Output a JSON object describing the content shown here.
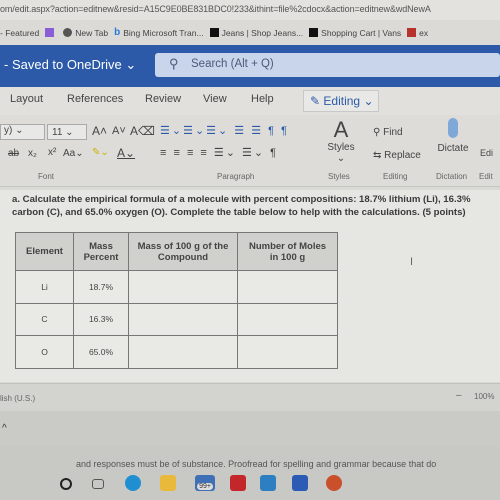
{
  "browser": {
    "url": "om/edit.aspx?action=editnew&resid=A15C9E0BE831BDC0!233&ithint=file%2cdocx&action=editnew&wdNewA",
    "bookmarks": [
      {
        "label": "- Featured",
        "icon": "none"
      },
      {
        "label": "",
        "icon": "twitch-icon"
      },
      {
        "label": "New Tab",
        "icon": "globe-icon"
      },
      {
        "label": "Bing Microsoft Tran...",
        "icon": "bing-icon"
      },
      {
        "label": "Jeans | Shop Jeans...",
        "icon": "vans-icon"
      },
      {
        "label": "Shopping Cart | Vans",
        "icon": "vans-icon"
      },
      {
        "label": "ex",
        "icon": "sy-icon"
      }
    ]
  },
  "header": {
    "saved": "- Saved to OneDrive",
    "search_placeholder": "Search (Alt + Q)",
    "brand_color": "#2c5aa8"
  },
  "tabs": [
    "Layout",
    "References",
    "Review",
    "View",
    "Help"
  ],
  "editing_mode": "Editing",
  "ribbon": {
    "font_size": "11",
    "groups": [
      "Font",
      "Paragraph",
      "Styles",
      "Editing",
      "Dictation",
      "Edit"
    ],
    "styles": "Styles",
    "find": "Find",
    "replace": "Replace",
    "dictate": "Dictate",
    "editor": "Edi"
  },
  "document": {
    "question": "a. Calculate the empirical formula of a molecule with percent compositions: 18.7% lithium (Li), 16.3% carbon (C), and 65.0% oxygen (O). Complete the table below to help with the calculations. (5 points)",
    "table": {
      "headers": [
        "Element",
        "Mass Percent",
        "Mass of 100 g of the Compound",
        "Number of Moles in 100 g"
      ],
      "rows": [
        [
          "Li",
          "18.7%",
          "",
          ""
        ],
        [
          "C",
          "16.3%",
          "",
          ""
        ],
        [
          "O",
          "65.0%",
          "",
          ""
        ]
      ]
    }
  },
  "status": {
    "language": "lish (U.S.)",
    "zoom": "100%"
  },
  "background_text": "and responses must be of substance. Proofread for spelling and grammar because that do",
  "taskbar": {
    "mail_badge": "99+"
  }
}
